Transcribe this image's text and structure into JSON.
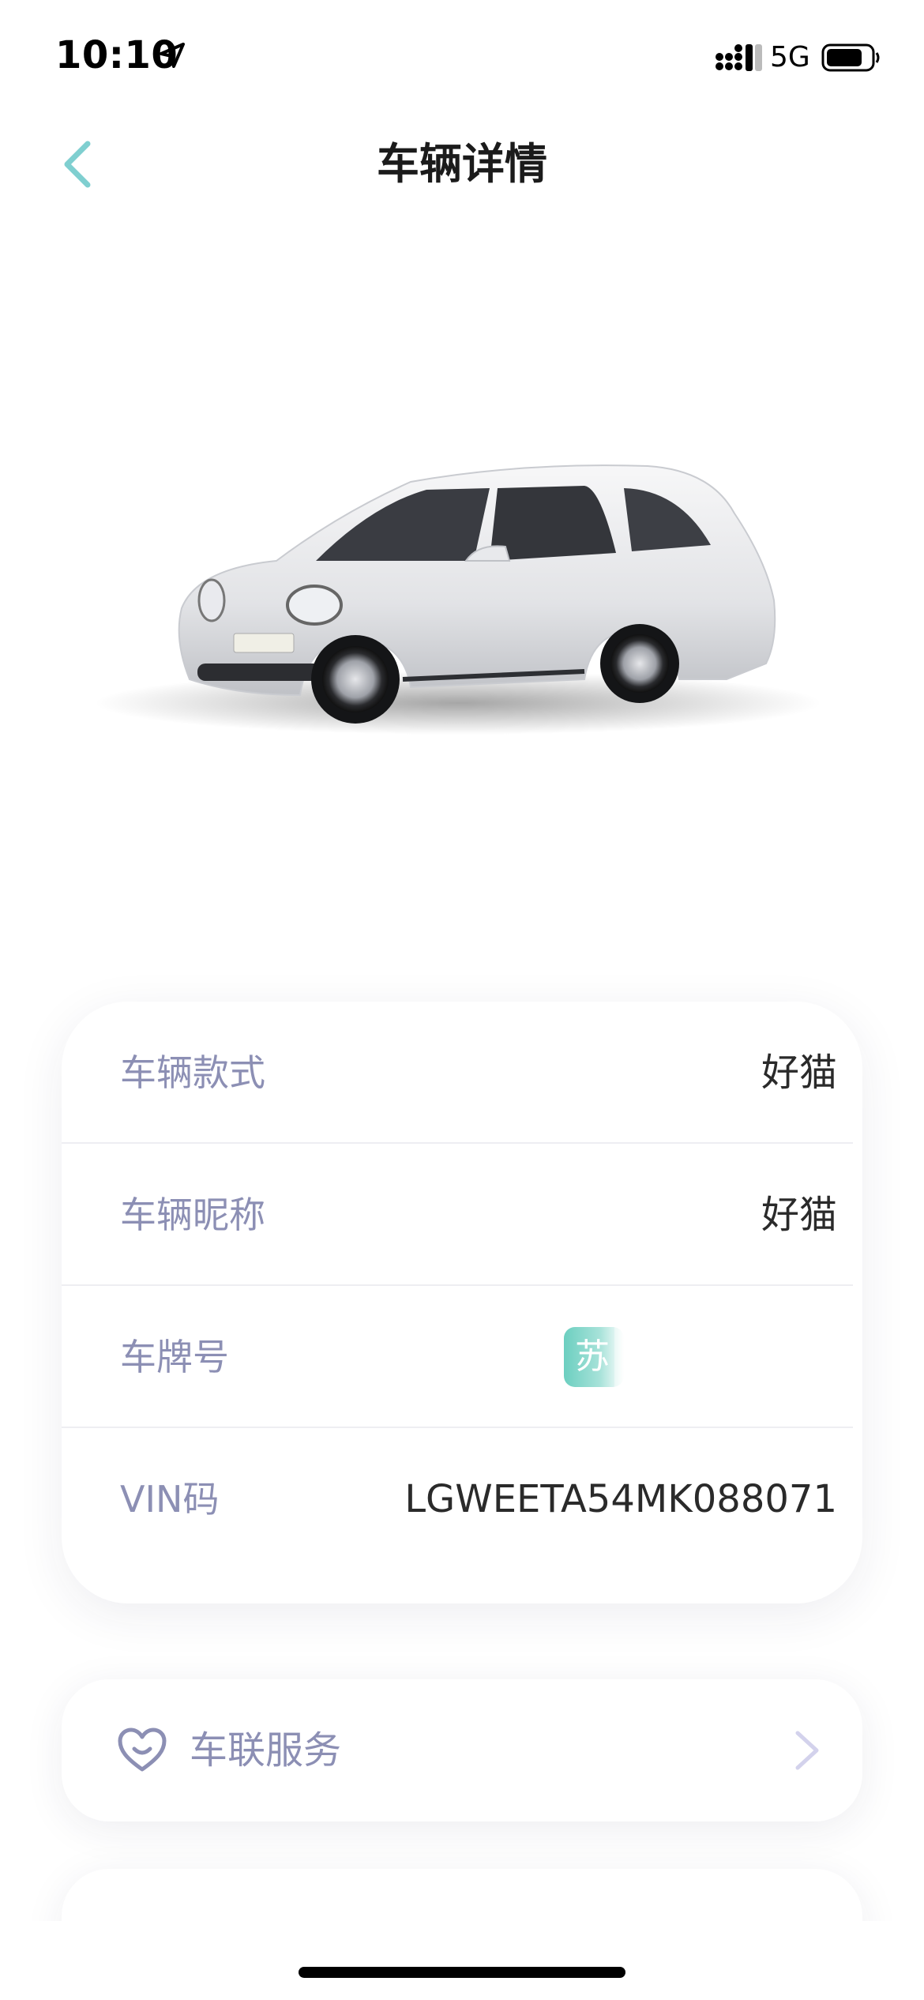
{
  "status_bar": {
    "time": "10:10",
    "network": "5G"
  },
  "header": {
    "title": "车辆详情"
  },
  "vehicle_info": {
    "rows": [
      {
        "label": "车辆款式",
        "value": "好猫"
      },
      {
        "label": "车辆昵称",
        "value": "好猫"
      },
      {
        "label": "车牌号",
        "plate_prefix": "苏"
      },
      {
        "label": "VIN码",
        "value": "LGWEETA54MK088071"
      }
    ]
  },
  "services": {
    "connected_label": "车联服务"
  },
  "colors": {
    "accent": "#7fcfd0",
    "label": "#8c8fb4",
    "plate": "#6ccfc0"
  }
}
